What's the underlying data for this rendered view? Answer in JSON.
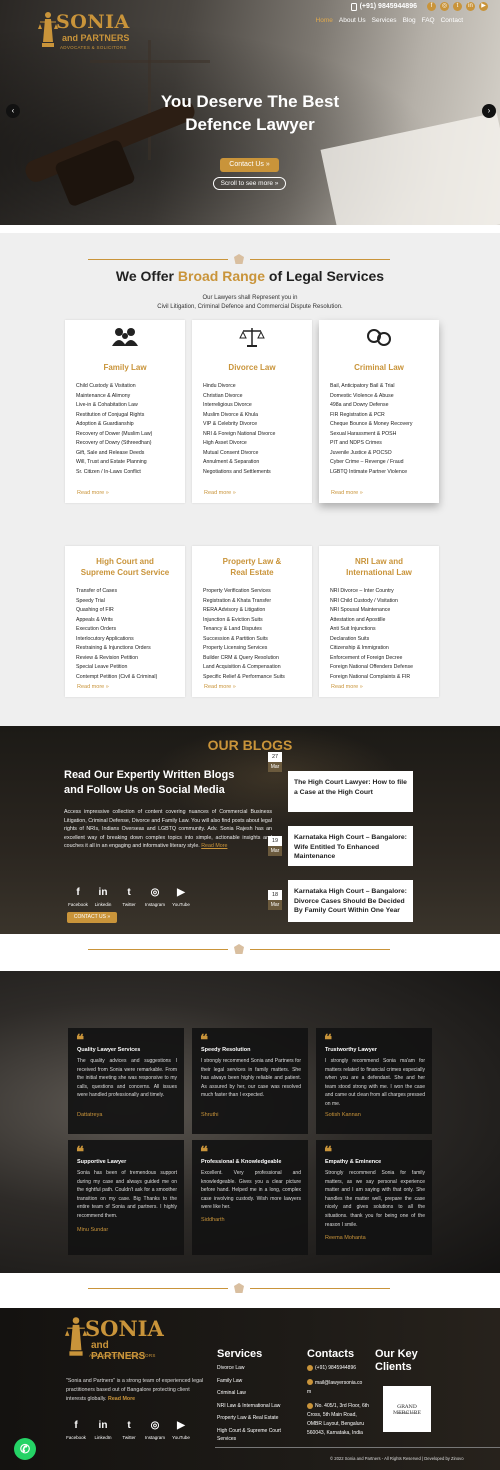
{
  "header": {
    "logo": {
      "name": "SONIA",
      "name2": "and PARTNERS",
      "tagline": "ADVOCATES & SOLICITORS"
    },
    "phone": "(+91) 9845944896",
    "nav": [
      "Home",
      "About Us",
      "Services",
      "Blog",
      "FAQ",
      "Contact"
    ],
    "active_nav": "Home"
  },
  "hero": {
    "title_line1": "You Deserve The Best",
    "title_line2": "Defence Lawyer",
    "cta": "Contact Us",
    "scroll": "Scroll to see more"
  },
  "services": {
    "title_pre": "We Offer",
    "title_gold": "Broad Range",
    "title_post": "of Legal Services",
    "subtitle_line1": "Our Lawyers shall Represent you in",
    "subtitle_line2": "Civil Litigation, Criminal Defence and Commercial Dispute Resolution.",
    "read_more": "Read more »",
    "cards": [
      {
        "title": "Family Law",
        "items": [
          "Child Custody & Visitation",
          "Maintenance & Alimony",
          "Live-in & Cohabitation Law",
          "Restitution of Conjugal Rights",
          "Adoption & Guardianship",
          "Recovery of Dower (Muslim Law)",
          "Recovery of Dowry (Sthreedhan)",
          "Gift, Sale and Release Deeds",
          "Will, Trust and Estate Planning",
          "Sr. Citizen / In-Laws Conflict"
        ]
      },
      {
        "title": "Divorce Law",
        "items": [
          "Hindu Divorce",
          "Christian Divorce",
          "Interreligious Divorce",
          "Muslim Divorce & Khula",
          "VIP & Celebrity Divorce",
          "NRI & Foreign National Divorce",
          "High Asset Divorce",
          "Mutual Consent Divorce",
          "Annulment & Separation",
          "Negotiations and Settlements"
        ]
      },
      {
        "title": "Criminal Law",
        "items": [
          "Bail, Anticipatory Bail & Trial",
          "Domestic Violence & Abuse",
          "498a and Dowry Defense",
          "FIR Registration & PCR",
          "Cheque Bounce & Money Recovery",
          "Sexual Harassment & POSH",
          "PIT and NDPS Crimes",
          "Juvenile Justice & POCSO",
          "Cyber Crime – Revenge / Fraud",
          "LGBTQ Intimate Partner Violence"
        ]
      },
      {
        "title_line1": "High Court and",
        "title_line2": "Supreme Court Service",
        "items": [
          "Transfer of Cases",
          "Speedy Trial",
          "Quashing of FIR",
          "Appeals & Writs",
          "Execution Orders",
          "Interlocutory Applications",
          "Restraining & Injunctions Orders",
          "Review & Revision Petition",
          "Special Leave Petition",
          "Contempt Petition (Civil & Criminal)"
        ]
      },
      {
        "title_line1": "Property Law &",
        "title_line2": "Real Estate",
        "items": [
          "Property Verification Services",
          "Registration & Khata Transfer",
          "RERA Advisory & Litigation",
          "Injunction & Eviction Suits",
          "Tenancy & Land Disputes",
          "Succession & Partition Suits",
          "Property Licensing Services",
          "Builder CRM & Query Resolution",
          "Land Acquisition & Compensation",
          "Specific Relief & Performance Suits"
        ]
      },
      {
        "title_line1": "NRI Law and",
        "title_line2": "International Law",
        "items": [
          "NRI Divorce – Inter Country",
          "NRI Child Custody / Visitation",
          "NRI Spousal Maintenance",
          "Attestation and Apostille",
          "Anti Suit Injunctions",
          "Declaration Suits",
          "Citizenship & Immigration",
          "Enforcement of Foreign Decree",
          "Foreign National Offenders Defense",
          "Foreign National Complaints & FIR"
        ]
      }
    ]
  },
  "blogs": {
    "title": "OUR BLOGS",
    "lead_line1": "Read Our Expertly Written Blogs",
    "lead_line2": "and Follow Us on Social Media",
    "text": "Access impressive collection of content covering nuances of Commercial Business Litigation, Criminal Defense, Divorce and Family Law. You will also find posts about legal rights of NRIs, Indians Overseas and LGBTQ community. Adv. Sonia Rajesh has an excellent way of breaking down complex topics into simple, actionable insights and couches it all in an engaging and informative literary style.",
    "read_more": "Read More",
    "social": [
      "Facebook",
      "Linkedin",
      "Twitter",
      "Instagram",
      "YouTube"
    ],
    "cta": "CONTACT US »",
    "posts": [
      {
        "day": "27",
        "month": "Mar",
        "title": "The High Court Lawyer: How to file a Case at the High Court"
      },
      {
        "day": "19",
        "month": "Mar",
        "title": "Karnataka High Court – Bangalore: Wife Entitled To Enhanced Maintenance"
      },
      {
        "day": "18",
        "month": "Mar",
        "title": "Karnataka High Court – Bangalore: Divorce Cases Should Be Decided By Family Court Within One Year"
      }
    ]
  },
  "testimonials": [
    {
      "title": "Quality Lawyer Services",
      "text": "The quality advices and suggestions I received from Sonia were remarkable. From the initial meeting she was responsive to my calls, questions and concerns. All issues were handled professionally and timely.",
      "author": "Dattatreya"
    },
    {
      "title": "Speedy Resolution",
      "text": "I strongly recommend Sonia and Partners for their legal services in family matters. She has always been highly reliable and patient. As assured by her, our case was resolved much faster than I expected.",
      "author": "Shruthi"
    },
    {
      "title": "Trustworthy Lawyer",
      "text": "I strongly recommend Sonia ma'am for matters related to financial crimes especially when you are a defendant. She and her team stood strong with me. I won the case and came out clean from all charges pressed on me.",
      "author": "Sotish Kannan"
    },
    {
      "title": "Supportive Lawyer",
      "text": "Sonia has been of tremendous support during my case and always guided me on the rightful path. Couldn't ask for a smoother transition on my case. Big Thanks to the entire team of Sonia and partners. I highly recommend them.",
      "author": "Minu Sundar"
    },
    {
      "title": "Professional & Knowledgeable",
      "text": "Excellent. Very professional and knowledgeable. Gives you a clear picture before hand. Helped me in a long, complex case involving custody. Wish more lawyers were like her.",
      "author": "Siddharth"
    },
    {
      "title": "Empathy & Eminence",
      "text": "Strongly recommend Sonia for family matters, as we say personal experience matter and I am saying with that only. She handles the matter well, prepare the case nicely and gives solutions to all the situations. thank you for being one of the reason I smile.",
      "author": "Reema Mohanta"
    }
  ],
  "footer": {
    "logo": {
      "name": "SONIA",
      "name2": "and PARTNERS",
      "tagline": "ADVOCATES & SOLICITORS"
    },
    "about": "\"Sonia and Partners\" is a strong team of experienced legal practitioners based out of Bangalore protecting client interests globally.",
    "read_more": "Read More",
    "social": [
      "Facebook",
      "LinkedIn",
      "Twitter",
      "Instagram",
      "YouTube"
    ],
    "services_title": "Services",
    "services": [
      "Divorce Law",
      "Family Law",
      "Criminal Law",
      "NRI Law & International Law",
      "Property Law & Real Estate",
      "High Court & Supreme Court Services"
    ],
    "contacts_title": "Contacts",
    "contact_phone": "(+91) 9845944896",
    "contact_email": "mail@lawyersonia.co",
    "contact_email2": "m",
    "contact_address": "No. 405/1, 3rd Floor, 6th Cross, 5th Main Road, OMBR Layout, Bengaluru 560043, Karnataka, India",
    "clients_title_line1": "Our Key",
    "clients_title_line2": "Clients",
    "client_name": "GRAND MERCURE",
    "client_sub": "BANGALORE",
    "copyright": "© 2022 Sonia and Partners - All Rights Reserved | Developed by Zinovo"
  }
}
